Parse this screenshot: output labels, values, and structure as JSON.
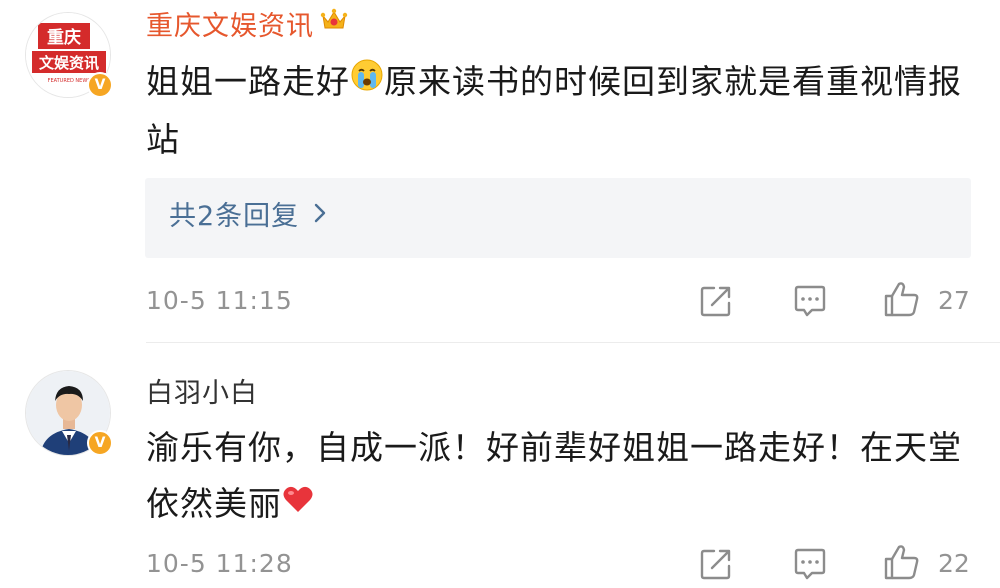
{
  "comments": [
    {
      "username": "重庆文娱资讯",
      "avatar_text_line1": "重庆",
      "avatar_text_line2": "文娱资讯",
      "avatar_small_text": "FEATURED NEWS",
      "text_before_emoji": "姐姐一路走好",
      "text_after_emoji": "原来读书的时候回到家就是看重视情报站",
      "reply_link": "共2条回复",
      "timestamp": "10-5 11:15",
      "like_count": "27"
    },
    {
      "username": "白羽小白",
      "text_main": "渝乐有你，自成一派！好前辈好姐姐一路走好！在天堂依然美丽",
      "timestamp": "10-5 11:28",
      "like_count": "22"
    }
  ],
  "colors": {
    "vip_name": "#e6572d",
    "link": "#4a6f95",
    "meta": "#939393",
    "verified": "#f6a623",
    "heart": "#e8343b"
  },
  "icons": [
    "crown-icon",
    "crying-emoji-icon",
    "chevron-right-icon",
    "share-icon",
    "comment-icon",
    "like-icon",
    "heart-emoji-icon",
    "verified-icon"
  ]
}
